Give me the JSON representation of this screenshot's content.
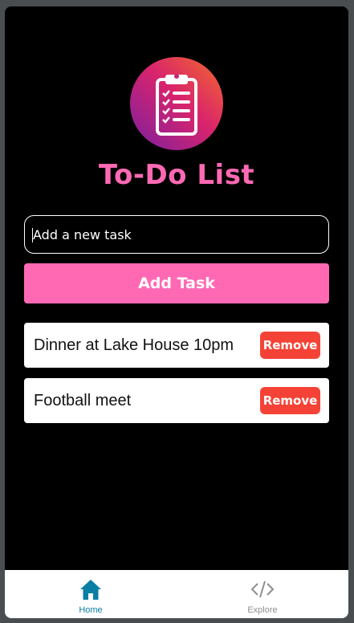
{
  "app": {
    "title": "To-Do List",
    "logo_icon": "clipboard-checklist-icon"
  },
  "input": {
    "placeholder": "Add a new task",
    "value": ""
  },
  "add_button": {
    "label": "Add Task"
  },
  "tasks": [
    {
      "text": "Dinner at Lake House 10pm",
      "remove_label": "Remove"
    },
    {
      "text": "Football meet",
      "remove_label": "Remove"
    }
  ],
  "tabs": [
    {
      "label": "Home",
      "icon": "home-icon",
      "active": true
    },
    {
      "label": "Explore",
      "icon": "code-icon",
      "active": false
    }
  ],
  "colors": {
    "accent": "#ff69b4",
    "remove": "#f44336",
    "active_tab": "#0a7ea4",
    "inactive_tab": "#8e8e8e",
    "background": "#000000"
  }
}
